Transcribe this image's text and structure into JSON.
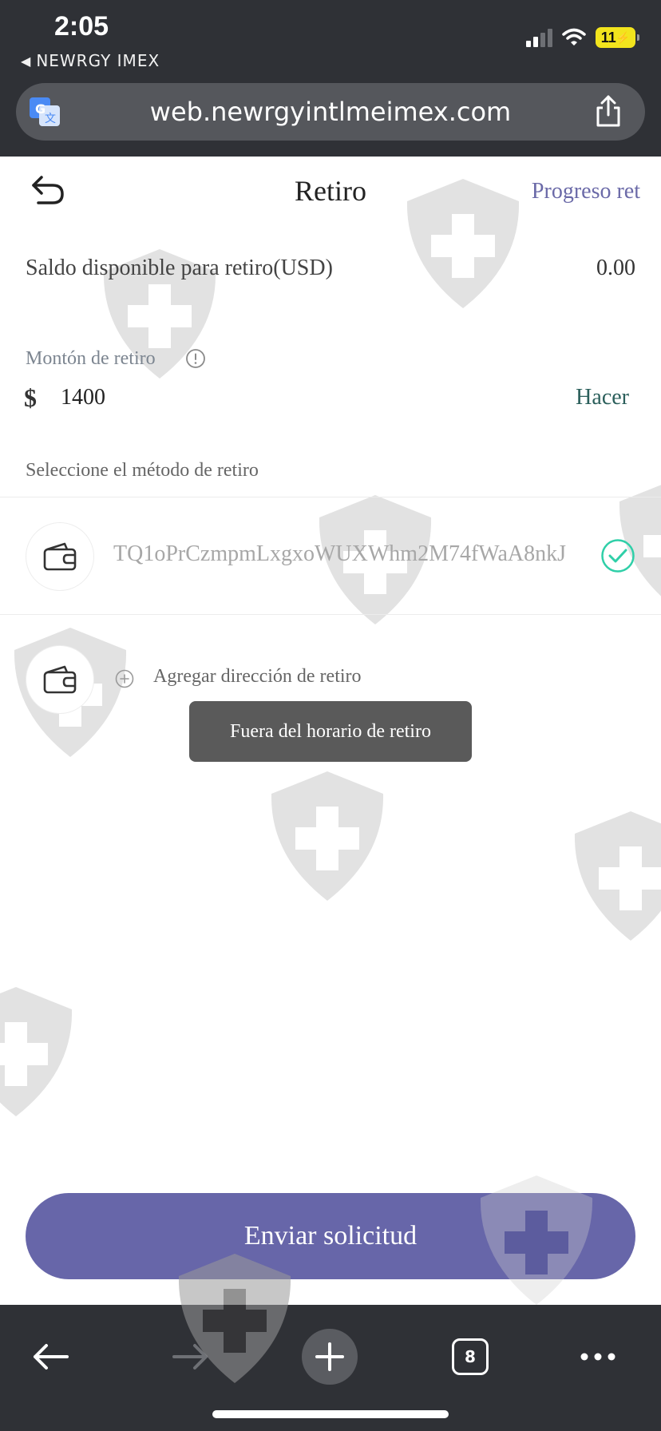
{
  "status_bar": {
    "time": "2:05",
    "back_app": "NEWRGY IMEX",
    "battery": "11"
  },
  "browser": {
    "url": "web.newrgyintlmeimex.com",
    "tab_count": "8"
  },
  "header": {
    "title": "Retiro",
    "progress_link": "Progreso ret"
  },
  "balance": {
    "label": "Saldo disponible para retiro(USD)",
    "value": "0.00"
  },
  "amount": {
    "label": "Montón de retiro",
    "currency_symbol": "$",
    "value": "1400",
    "max_label": "Hacer"
  },
  "method": {
    "label": "Seleccione el método de retiro",
    "address": "TQ1oPrCzmpmLxgxoWUXWhm2M74fWaA8nkJ",
    "add_label": "Agregar dirección de retiro"
  },
  "toast": {
    "message": "Fuera del horario de retiro"
  },
  "submit": {
    "label": "Enviar solicitud"
  },
  "colors": {
    "chrome": "#2f3136",
    "accent": "#6766a9",
    "link": "#6b6aa8",
    "check": "#2fcfa8",
    "battery": "#f2e41d"
  },
  "icons": [
    "translate-icon",
    "share-icon",
    "back-arrow-icon",
    "info-icon",
    "wallet-icon",
    "check-circle-icon",
    "add-circle-icon",
    "arrow-left-icon",
    "arrow-right-icon",
    "plus-icon",
    "tabs-icon",
    "more-icon"
  ]
}
